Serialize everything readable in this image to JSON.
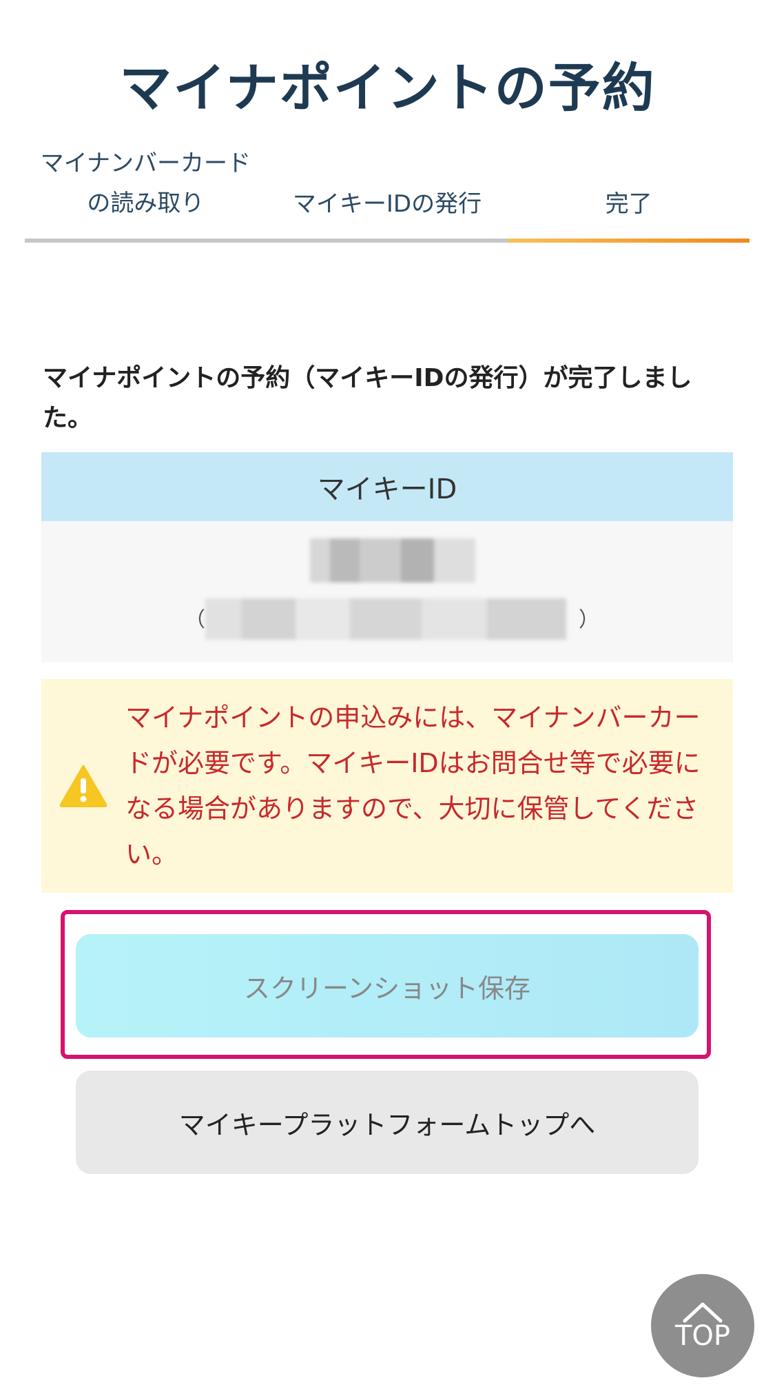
{
  "page": {
    "title": "マイナポイントの予約"
  },
  "steps": [
    {
      "label": "マイナンバーカード\nの読み取り",
      "active": false
    },
    {
      "label": "マイキーIDの発行",
      "active": false
    },
    {
      "label": "完了",
      "active": true
    }
  ],
  "message": "マイナポイントの予約（マイキーIDの発行）が完了しました。",
  "mykey": {
    "header": "マイキーID",
    "paren_open": "（",
    "paren_close": "）"
  },
  "notice": {
    "icon": "warning-icon",
    "text": "マイナポイントの申込みには、マイナンバーカードが必要です。マイキーIDはお問合せ等で必要になる場合がありますので、大切に保管してください。",
    "color": "#c8282c",
    "background": "#fff8d8"
  },
  "buttons": {
    "screenshot": "スクリーンショット保存",
    "platform_top": "マイキープラットフォームトップへ"
  },
  "top_button": {
    "label": "TOP",
    "icon": "chevron-up-icon"
  },
  "colors": {
    "title": "#1e3a52",
    "active_step": "#f08a1c",
    "highlight": "#d6126e",
    "screenshot_button": "#b6f3f8"
  }
}
